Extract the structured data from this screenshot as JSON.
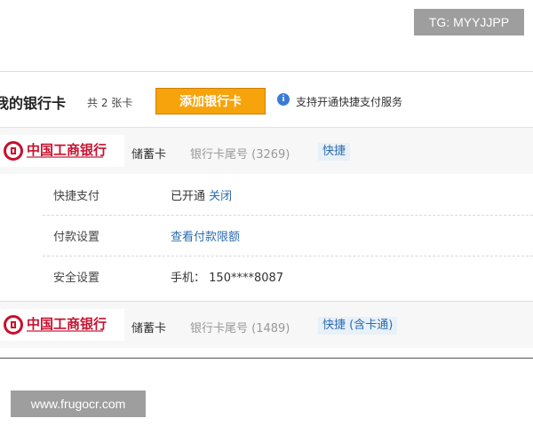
{
  "watermarks": {
    "tg": "TG: MYYJJPP",
    "site": "www.frugocr.com"
  },
  "header": {
    "title": "我的银行卡",
    "count": "共 2 张卡",
    "add_button": "添加银行卡",
    "info_icon": "info-icon",
    "support_text": "支持开通快捷支付服务"
  },
  "cards": [
    {
      "bank_name": "中国工商银行",
      "card_type": "储蓄卡",
      "tail": "银行卡尾号 (3269)",
      "tag": "快捷"
    },
    {
      "bank_name": "中国工商银行",
      "card_type": "储蓄卡",
      "tail": "银行卡尾号 (1489)",
      "tag": "快捷 (含卡通)"
    }
  ],
  "details": {
    "quick_pay": {
      "label": "快捷支付",
      "status": "已开通",
      "action": "关闭"
    },
    "payment": {
      "label": "付款设置",
      "link": "查看付款限额"
    },
    "security": {
      "label": "安全设置",
      "phone_label": "手机：",
      "phone": "150****8087"
    }
  },
  "colors": {
    "accent": "#f6a30c",
    "link": "#2b6cb0",
    "brand": "#c8102e"
  }
}
